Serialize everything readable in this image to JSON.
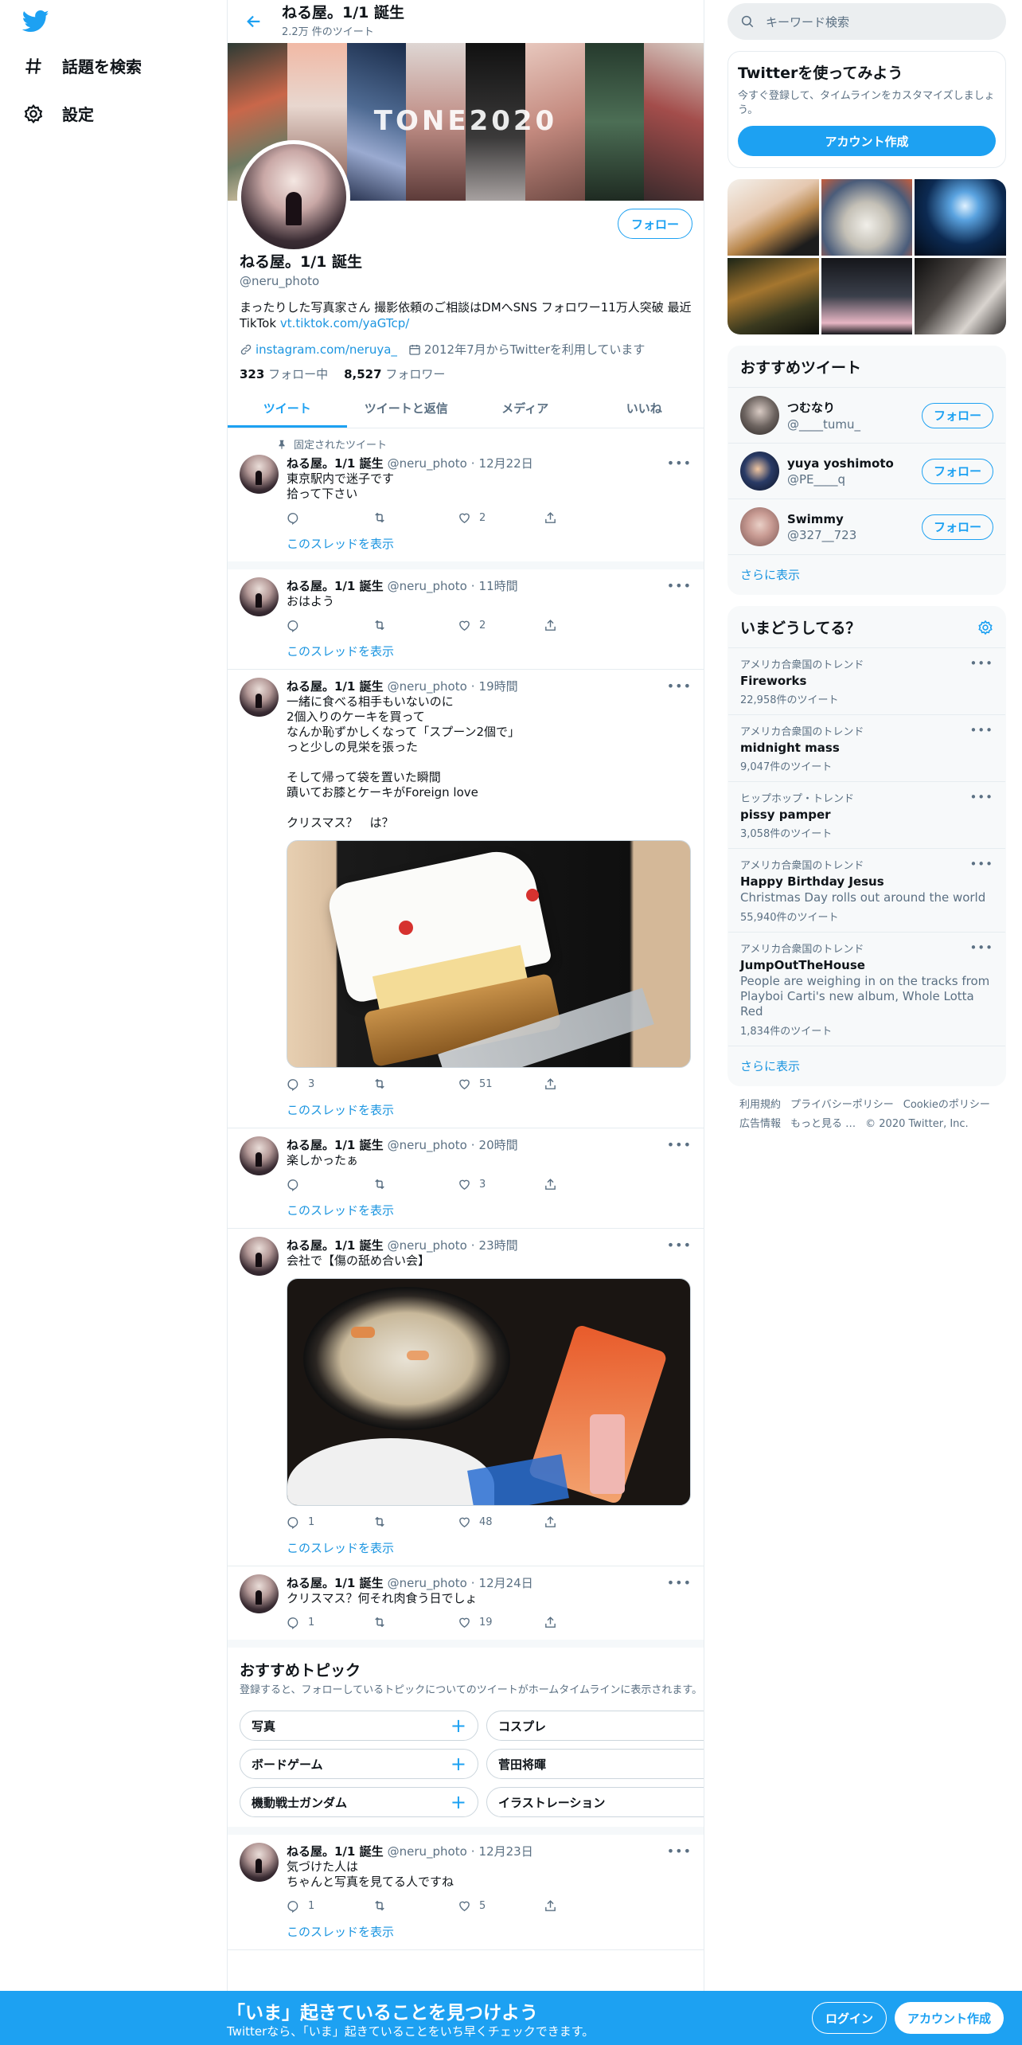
{
  "nav": {
    "logo": "twitter-bird-icon",
    "items": [
      {
        "label": "話題を検索",
        "icon": "hashtag-icon"
      },
      {
        "label": "設定",
        "icon": "gear-icon"
      }
    ]
  },
  "header": {
    "name": "ねる屋。1/1 誕生",
    "tweet_count": "2.2万 件のツイート"
  },
  "banner": {
    "text": "TONE2020"
  },
  "profile": {
    "name": "ねる屋。1/1 誕生",
    "handle": "@neru_photo",
    "bio": "まったりした写真家さん 撮影依頼のご相談はDMへSNS フォロワー11万人突破 最近TikTok ",
    "bio_link": "vt.tiktok.com/yaGTcp/",
    "website": "instagram.com/neruya_",
    "joined": "2012年7月からTwitterを利用しています",
    "following_count": "323",
    "following_label": " フォロー中",
    "followers_count": "8,527",
    "followers_label": " フォロワー",
    "follow_button": "フォロー"
  },
  "tabs": [
    "ツイート",
    "ツイートと返信",
    "メディア",
    "いいね"
  ],
  "pinned_label": "固定されたツイート",
  "thread_label": "このスレッドを表示",
  "tweets": [
    {
      "name": "ねる屋。1/1 誕生",
      "handle": "@neru_photo",
      "time": "12月22日",
      "text": "東京駅内で迷子です\n拾って下さい",
      "replies": "",
      "retweets": "",
      "likes": "2"
    },
    {
      "name": "ねる屋。1/1 誕生",
      "handle": "@neru_photo",
      "time": "11時間",
      "text": "おはよう",
      "replies": "",
      "retweets": "",
      "likes": "2"
    },
    {
      "name": "ねる屋。1/1 誕生",
      "handle": "@neru_photo",
      "time": "19時間",
      "text": "一緒に食べる相手もいないのに\n2個入りのケーキを買って\nなんか恥ずかしくなって「スプーン2個で」\nっと少しの見栄を張った\n\nそして帰って袋を置いた瞬間\n蹟いてお膝とケーキがForeign love\n\nクリスマス？　は？",
      "replies": "3",
      "retweets": "",
      "likes": "51"
    },
    {
      "name": "ねる屋。1/1 誕生",
      "handle": "@neru_photo",
      "time": "20時間",
      "text": "楽しかったぁ",
      "replies": "",
      "retweets": "",
      "likes": "3"
    },
    {
      "name": "ねる屋。1/1 誕生",
      "handle": "@neru_photo",
      "time": "23時間",
      "text": "会社で【傷の舐め合い会】",
      "replies": "1",
      "retweets": "",
      "likes": "48"
    },
    {
      "name": "ねる屋。1/1 誕生",
      "handle": "@neru_photo",
      "time": "12月24日",
      "text": "クリスマス？何それ肉食う日でしょ",
      "replies": "1",
      "retweets": "",
      "likes": "19"
    },
    {
      "name": "ねる屋。1/1 誕生",
      "handle": "@neru_photo",
      "time": "12月23日",
      "text": "気づけた人は\nちゃんと写真を見てる人ですね",
      "replies": "1",
      "retweets": "",
      "likes": "5"
    }
  ],
  "topics": {
    "title": "おすすめトピック",
    "subtitle": "登録すると、フォローしているトピックについてのツイートがホームタイムラインに表示されます。",
    "items": [
      "写真",
      "コスプレ",
      "ボードゲーム",
      "菅田将暉",
      "機動戦士ガンダム",
      "イラストレーション"
    ]
  },
  "search": {
    "placeholder": "キーワード検索"
  },
  "signup_card": {
    "title": "Twitterを使ってみよう",
    "text": "今すぐ登録して、タイムラインをカスタマイズしましょう。",
    "button": "アカウント作成"
  },
  "who_to_follow": {
    "title": "おすすめツイート",
    "users": [
      {
        "name": "つむなり",
        "handle": "@____tumu_"
      },
      {
        "name": "yuya yoshimoto",
        "handle": "@PE____q"
      },
      {
        "name": "Swimmy",
        "handle": "@327__723"
      }
    ],
    "follow_label": "フォロー",
    "more": "さらに表示"
  },
  "trends": {
    "title": "いまどうしてる？",
    "items": [
      {
        "context": "アメリカ合衆国のトレンド",
        "name": "Fireworks",
        "desc": "",
        "count": "22,958件のツイート"
      },
      {
        "context": "アメリカ合衆国のトレンド",
        "name": "midnight mass",
        "desc": "",
        "count": "9,047件のツイート"
      },
      {
        "context": "ヒップホップ・トレンド",
        "name": "pissy pamper",
        "desc": "",
        "count": "3,058件のツイート"
      },
      {
        "context": "アメリカ合衆国のトレンド",
        "name": "Happy Birthday Jesus",
        "desc": "Christmas Day rolls out around the world",
        "count": "55,940件のツイート"
      },
      {
        "context": "アメリカ合衆国のトレンド",
        "name": "JumpOutTheHouse",
        "desc": "People are weighing in on the tracks from Playboi Carti's new album, Whole Lotta Red",
        "count": "1,834件のツイート"
      }
    ],
    "more": "さらに表示"
  },
  "footer": [
    "利用規約",
    "プライバシーポリシー",
    "Cookieのポリシー",
    "広告情報",
    "もっと見る …",
    "© 2020 Twitter, Inc."
  ],
  "bottom_bar": {
    "title": "「いま」起きていることを見つけよう",
    "subtitle": "Twitterなら、「いま」起きていることをいち早くチェックできます。",
    "login": "ログイン",
    "signup": "アカウント作成"
  },
  "colors": {
    "accent": "#1da1f2",
    "link": "#1b95e0",
    "muted": "#5b7083"
  }
}
